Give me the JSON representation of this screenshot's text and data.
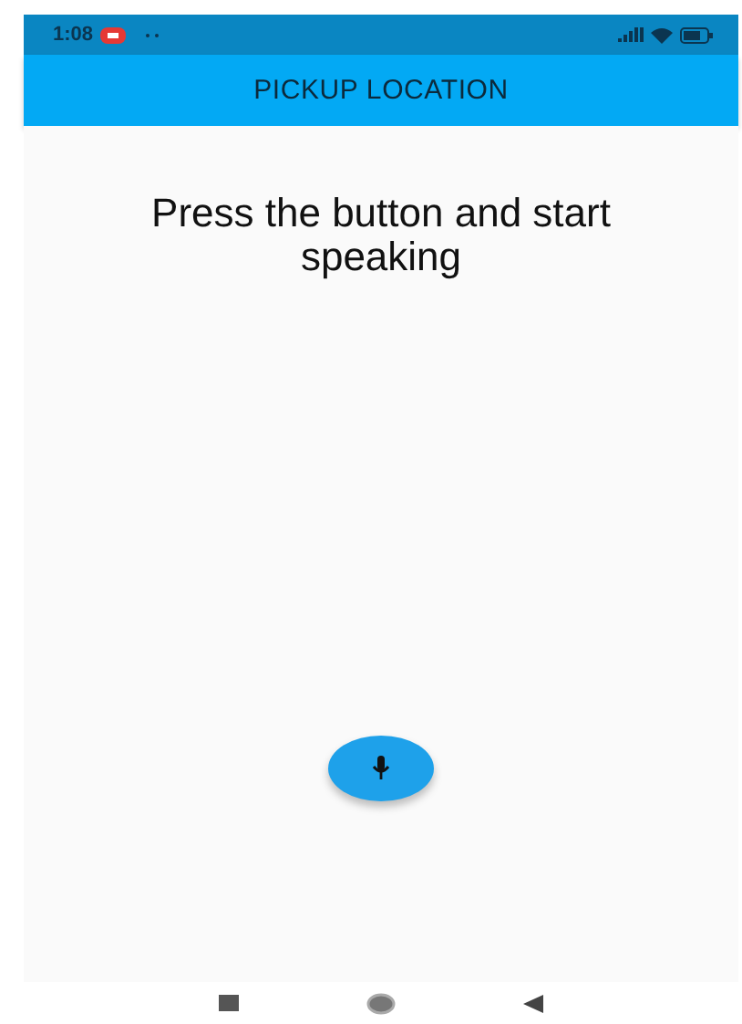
{
  "status_bar": {
    "time": "1:08"
  },
  "app_bar": {
    "title": "PICKUP LOCATION"
  },
  "prompt": "Press the button and start speaking"
}
